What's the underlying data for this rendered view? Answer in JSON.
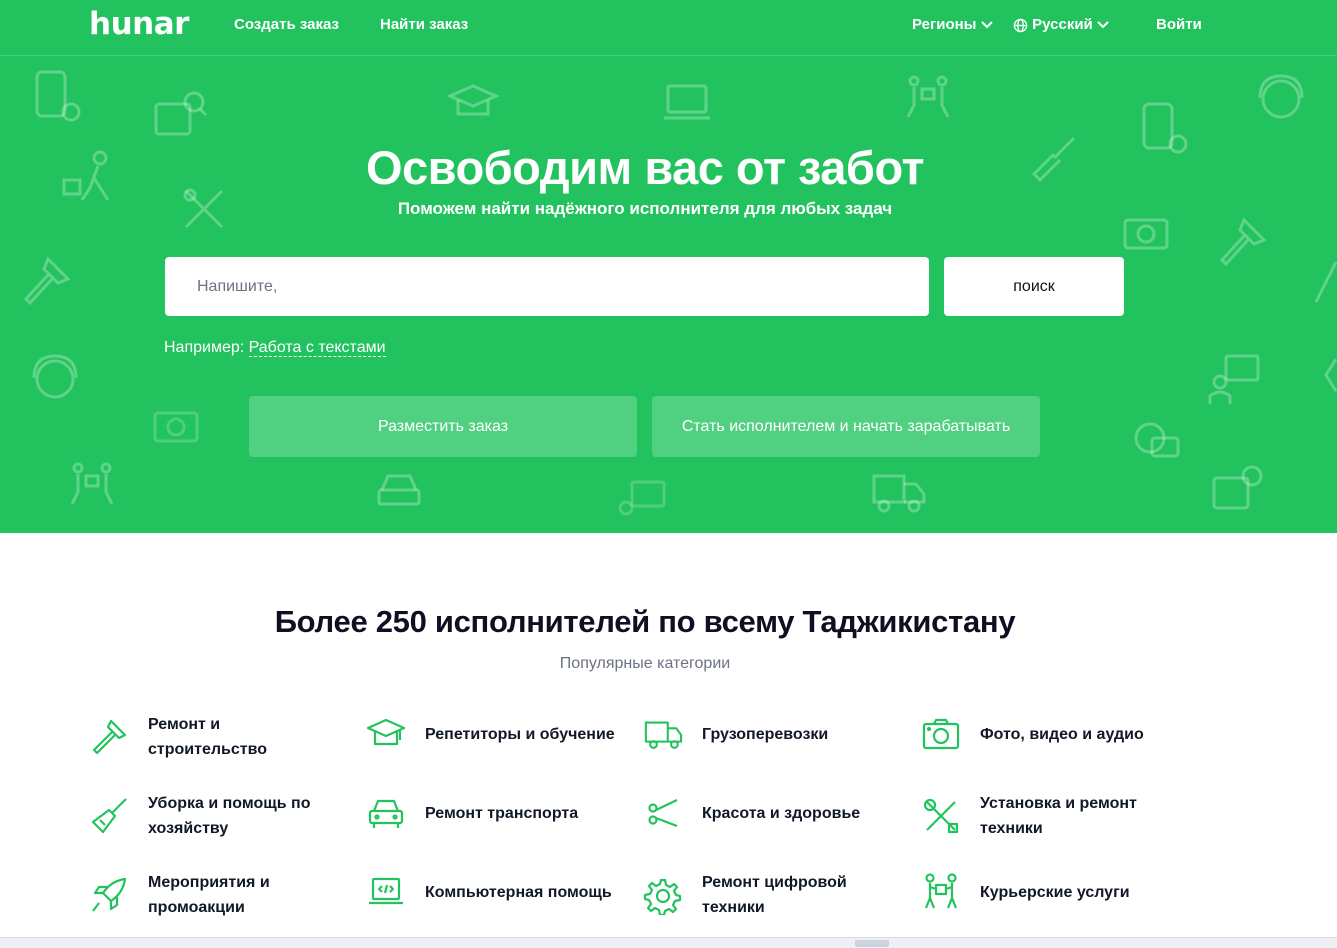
{
  "nav": {
    "logo": "hunar",
    "create_order": "Создать заказ",
    "find_order": "Найти заказ",
    "regions": "Регионы",
    "language": "Русский",
    "login": "Войти"
  },
  "hero": {
    "title": "Освободим вас от забот",
    "subtitle": "Поможем найти надёжного исполнителя для любых задач",
    "search_placeholder": "Напишите,",
    "search_button": "поиск",
    "example_prefix": "Например: ",
    "example_link": "Работа с текстами",
    "cta_post_order": "Разместить заказ",
    "cta_become_worker": "Стать исполнителем и начать зарабатывать"
  },
  "categories_section": {
    "title": "Более 250 исполнителей по всему Таджикистану",
    "subtitle": "Популярные категории",
    "items": [
      {
        "label": "Ремонт и строительство",
        "icon": "hammer-icon"
      },
      {
        "label": "Репетиторы и обучение",
        "icon": "graduation-cap-icon"
      },
      {
        "label": "Грузоперевозки",
        "icon": "truck-icon"
      },
      {
        "label": "Фото, видео и аудио",
        "icon": "camera-icon"
      },
      {
        "label": "Уборка и помощь по хозяйству",
        "icon": "broom-icon"
      },
      {
        "label": "Ремонт транспорта",
        "icon": "car-icon"
      },
      {
        "label": "Красота и здоровье",
        "icon": "scissors-icon"
      },
      {
        "label": "Установка и ремонт техники",
        "icon": "tools-icon"
      },
      {
        "label": "Мероприятия и промоакции",
        "icon": "rocket-icon"
      },
      {
        "label": "Компьютерная помощь",
        "icon": "laptop-code-icon"
      },
      {
        "label": "Ремонт цифровой техники",
        "icon": "gear-icon"
      },
      {
        "label": "Курьерские услуги",
        "icon": "couriers-icon"
      }
    ]
  },
  "colors": {
    "brand_green": "#22c35e",
    "icon_green": "#22c35e"
  }
}
